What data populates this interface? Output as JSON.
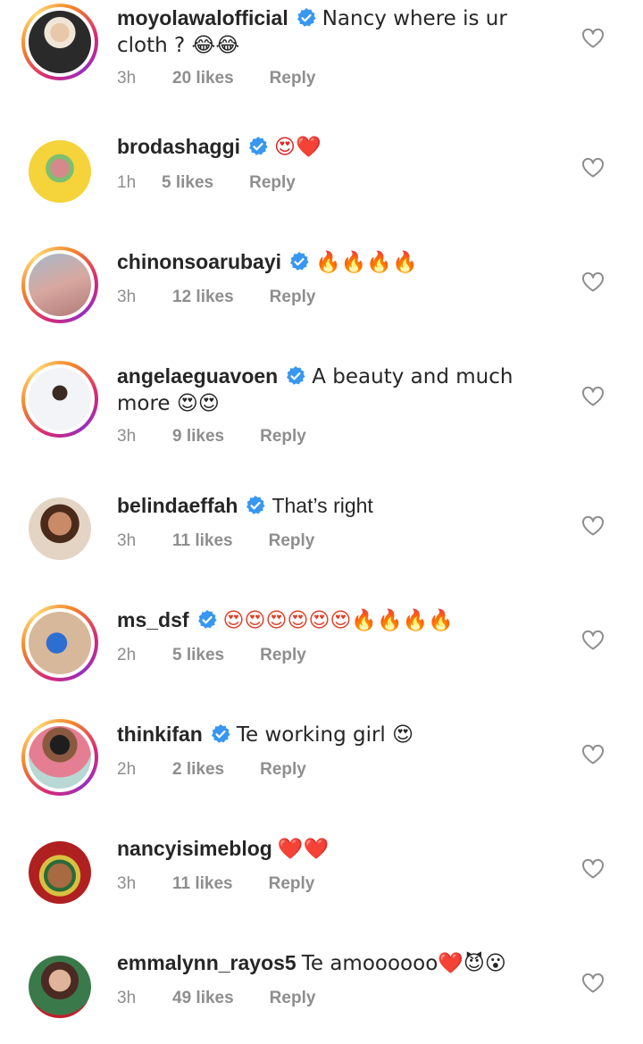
{
  "comments": [
    {
      "username": "moyolawalofficial",
      "verified": true,
      "text": "Nancy where is ur cloth ? 😂😂",
      "time": "3h",
      "likes": "20 likes",
      "reply": "Reply",
      "ring": true,
      "avatar_color": "#1a1a1a"
    },
    {
      "username": "brodashaggi",
      "verified": true,
      "text": "😍❤️",
      "time": "1h",
      "likes": "5 likes",
      "reply": "Reply",
      "ring": false,
      "avatar_color": "#f5d33a"
    },
    {
      "username": "chinonsoarubayi",
      "verified": true,
      "text": "🔥🔥🔥🔥",
      "time": "3h",
      "likes": "12 likes",
      "reply": "Reply",
      "ring": true,
      "avatar_color": "#c7a5a0"
    },
    {
      "username": "angelaeguavoen",
      "verified": true,
      "text": "A beauty and much more 😍😍",
      "time": "3h",
      "likes": "9 likes",
      "reply": "Reply",
      "ring": true,
      "avatar_color": "#dfe6ee"
    },
    {
      "username": "belindaeffah",
      "verified": true,
      "text": "That’s right",
      "time": "3h",
      "likes": "11 likes",
      "reply": "Reply",
      "ring": false,
      "avatar_color": "#b77a5c"
    },
    {
      "username": "ms_dsf",
      "verified": true,
      "text": "😍😍😍😍😍😍🔥🔥🔥🔥",
      "time": "2h",
      "likes": "5 likes",
      "reply": "Reply",
      "ring": true,
      "avatar_color": "#c8a78c"
    },
    {
      "username": "thinkifan",
      "verified": true,
      "text": "Te working girl 😍",
      "time": "2h",
      "likes": "2 likes",
      "reply": "Reply",
      "ring": true,
      "avatar_color": "#e78b9b"
    },
    {
      "username": "nancyisimeblog",
      "verified": false,
      "text": "❤️❤️",
      "time": "3h",
      "likes": "11 likes",
      "reply": "Reply",
      "ring": false,
      "avatar_color": "#7a5a3a"
    },
    {
      "username": "emmalynn_rayos5",
      "verified": false,
      "text": "Te amoooooo❤️😈😮",
      "time": "3h",
      "likes": "49 likes",
      "reply": "Reply",
      "ring": false,
      "avatar_color": "#a9656a"
    }
  ],
  "colors": {
    "username": "#262626",
    "meta": "#8e8e8e",
    "verified": "#3897f0"
  },
  "icons": {
    "verified": "verified-badge-icon",
    "like": "heart-outline-icon"
  }
}
